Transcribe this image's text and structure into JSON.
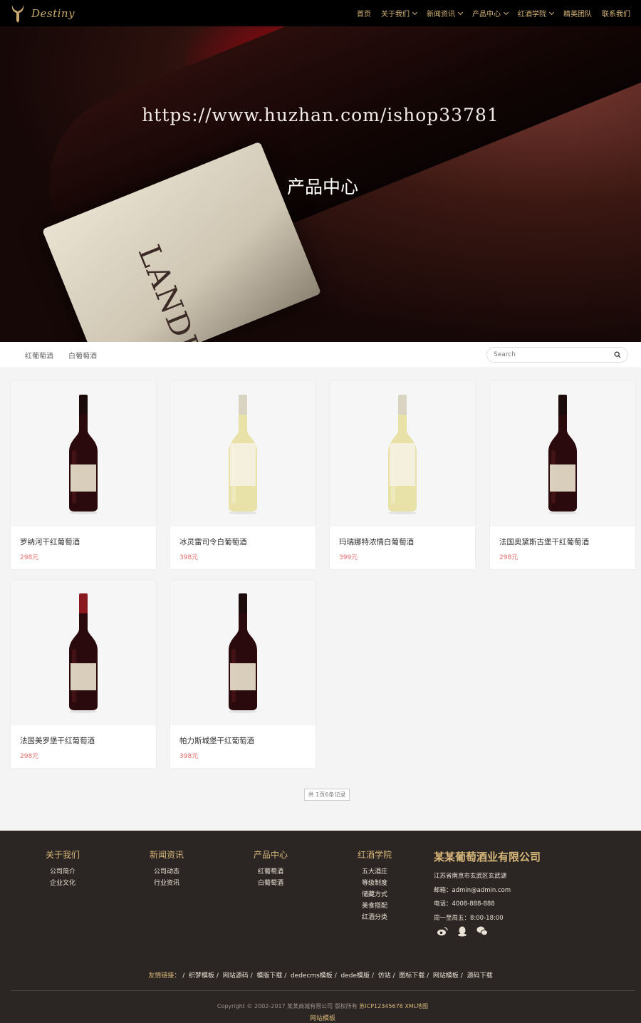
{
  "header": {
    "logo_text": "Destiny",
    "nav": [
      {
        "label": "首页",
        "dropdown": false
      },
      {
        "label": "关于我们",
        "dropdown": true
      },
      {
        "label": "新闻资讯",
        "dropdown": true
      },
      {
        "label": "产品中心",
        "dropdown": true
      },
      {
        "label": "红酒学院",
        "dropdown": true
      },
      {
        "label": "精英团队",
        "dropdown": false
      },
      {
        "label": "联系我们",
        "dropdown": false
      }
    ]
  },
  "hero": {
    "watermark": "https://www.huzhan.com/ishop33781",
    "title": "产品中心",
    "label_text": "LANDIERS"
  },
  "filter": {
    "categories": [
      "红葡萄酒",
      "白葡萄酒"
    ],
    "search_placeholder": "Search"
  },
  "products": [
    {
      "name": "罗纳河干红葡萄酒",
      "price": "298元",
      "wine": "red"
    },
    {
      "name": "冰灵雷司令白葡萄酒",
      "price": "398元",
      "wine": "white"
    },
    {
      "name": "玛瑞娜特浓情白葡萄酒",
      "price": "399元",
      "wine": "white"
    },
    {
      "name": "法国奥黛斯古堡干红葡萄酒",
      "price": "298元",
      "wine": "red"
    },
    {
      "name": "法国美罗堡干红葡萄酒",
      "price": "298元",
      "wine": "red"
    },
    {
      "name": "帕力斯城堡干红葡萄酒",
      "price": "398元",
      "wine": "red"
    }
  ],
  "pager": "共 1页6条记录",
  "footer": {
    "columns": [
      {
        "title": "关于我们",
        "links": [
          "公司简介",
          "企业文化"
        ]
      },
      {
        "title": "新闻资讯",
        "links": [
          "公司动态",
          "行业资讯"
        ]
      },
      {
        "title": "产品中心",
        "links": [
          "红葡萄酒",
          "白葡萄酒"
        ]
      },
      {
        "title": "红酒学院",
        "links": [
          "五大酒庄",
          "等级制度",
          "储藏方式",
          "美食搭配",
          "红酒分类"
        ]
      }
    ],
    "company": {
      "name": "某某葡萄酒业有限公司",
      "address": "江苏省南京市玄武区玄武湖",
      "email": "邮箱：admin@admin.com",
      "phone": "电话：4008-888-888",
      "hours": "周一至周五：8:00-18:00"
    },
    "links_label": "友情链接：",
    "links": [
      "织梦模板",
      "网站源码",
      "模版下载",
      "dedecms模板",
      "dede模版",
      "仿站",
      "图标下载",
      "网站模板",
      "源码下载"
    ],
    "copyright": "Copyright © 2002-2017 某某商城有限公司 版权所有",
    "icp": "苏ICP12345678",
    "sitemap": "XML地图",
    "model": "网站模板"
  },
  "colors": {
    "gold": "#d8b77a",
    "price": "#e56b6b",
    "footer_bg": "#2b2623"
  }
}
